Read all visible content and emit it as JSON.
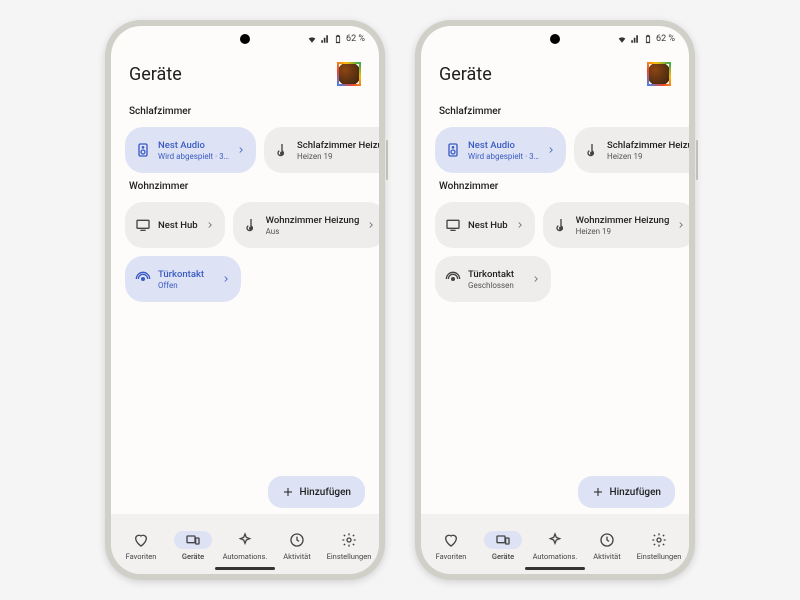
{
  "status": {
    "battery": "62 %"
  },
  "header": {
    "title": "Geräte"
  },
  "fab": {
    "label": "Hinzufügen"
  },
  "nav": {
    "items": [
      {
        "label": "Favoriten"
      },
      {
        "label": "Geräte"
      },
      {
        "label": "Automations."
      },
      {
        "label": "Aktivität"
      },
      {
        "label": "Einstellungen"
      }
    ]
  },
  "phones": [
    {
      "rooms": [
        {
          "name": "Schlafzimmer",
          "tiles": [
            {
              "icon": "speaker",
              "title": "Nest Audio",
              "sub": "Wird abgespielt · 3…",
              "active": true
            },
            {
              "icon": "thermostat",
              "title": "Schlafzimmer Heizung",
              "sub": "Heizen 19",
              "active": false
            }
          ]
        },
        {
          "name": "Wohnzimmer",
          "tiles": [
            {
              "icon": "display",
              "title": "Nest Hub",
              "sub": "",
              "active": false
            },
            {
              "icon": "thermostat",
              "title": "Wohnzimmer Heizung",
              "sub": "Aus",
              "active": false
            },
            {
              "icon": "sensor",
              "title": "Türkontakt",
              "sub": "Offen",
              "active": true
            }
          ]
        }
      ]
    },
    {
      "rooms": [
        {
          "name": "Schlafzimmer",
          "tiles": [
            {
              "icon": "speaker",
              "title": "Nest Audio",
              "sub": "Wird abgespielt · 3…",
              "active": true
            },
            {
              "icon": "thermostat",
              "title": "Schlafzimmer Heizung",
              "sub": "Heizen 19",
              "active": false
            }
          ]
        },
        {
          "name": "Wohnzimmer",
          "tiles": [
            {
              "icon": "display",
              "title": "Nest Hub",
              "sub": "",
              "active": false
            },
            {
              "icon": "thermostat",
              "title": "Wohnzimmer Heizung",
              "sub": "Heizen 19",
              "active": false
            },
            {
              "icon": "sensor",
              "title": "Türkontakt",
              "sub": "Geschlossen",
              "active": false
            }
          ]
        }
      ]
    }
  ]
}
